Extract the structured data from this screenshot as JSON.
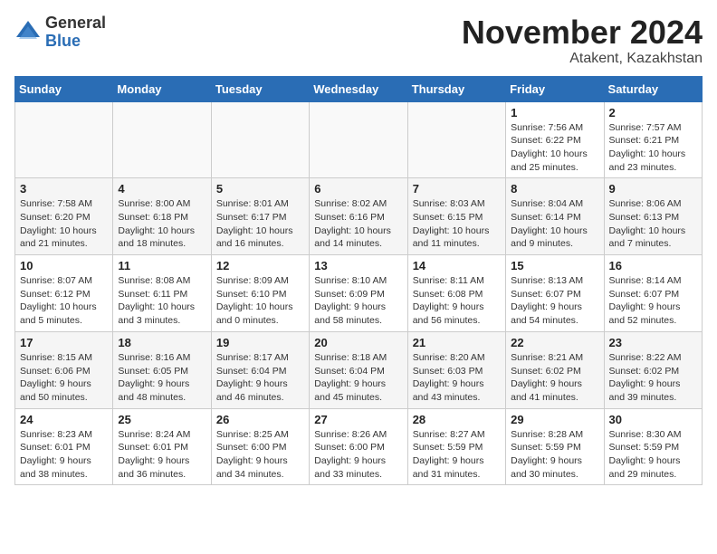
{
  "header": {
    "logo_general": "General",
    "logo_blue": "Blue",
    "month_title": "November 2024",
    "location": "Atakent, Kazakhstan"
  },
  "weekdays": [
    "Sunday",
    "Monday",
    "Tuesday",
    "Wednesday",
    "Thursday",
    "Friday",
    "Saturday"
  ],
  "weeks": [
    [
      {
        "day": "",
        "info": ""
      },
      {
        "day": "",
        "info": ""
      },
      {
        "day": "",
        "info": ""
      },
      {
        "day": "",
        "info": ""
      },
      {
        "day": "",
        "info": ""
      },
      {
        "day": "1",
        "info": "Sunrise: 7:56 AM\nSunset: 6:22 PM\nDaylight: 10 hours and 25 minutes."
      },
      {
        "day": "2",
        "info": "Sunrise: 7:57 AM\nSunset: 6:21 PM\nDaylight: 10 hours and 23 minutes."
      }
    ],
    [
      {
        "day": "3",
        "info": "Sunrise: 7:58 AM\nSunset: 6:20 PM\nDaylight: 10 hours and 21 minutes."
      },
      {
        "day": "4",
        "info": "Sunrise: 8:00 AM\nSunset: 6:18 PM\nDaylight: 10 hours and 18 minutes."
      },
      {
        "day": "5",
        "info": "Sunrise: 8:01 AM\nSunset: 6:17 PM\nDaylight: 10 hours and 16 minutes."
      },
      {
        "day": "6",
        "info": "Sunrise: 8:02 AM\nSunset: 6:16 PM\nDaylight: 10 hours and 14 minutes."
      },
      {
        "day": "7",
        "info": "Sunrise: 8:03 AM\nSunset: 6:15 PM\nDaylight: 10 hours and 11 minutes."
      },
      {
        "day": "8",
        "info": "Sunrise: 8:04 AM\nSunset: 6:14 PM\nDaylight: 10 hours and 9 minutes."
      },
      {
        "day": "9",
        "info": "Sunrise: 8:06 AM\nSunset: 6:13 PM\nDaylight: 10 hours and 7 minutes."
      }
    ],
    [
      {
        "day": "10",
        "info": "Sunrise: 8:07 AM\nSunset: 6:12 PM\nDaylight: 10 hours and 5 minutes."
      },
      {
        "day": "11",
        "info": "Sunrise: 8:08 AM\nSunset: 6:11 PM\nDaylight: 10 hours and 3 minutes."
      },
      {
        "day": "12",
        "info": "Sunrise: 8:09 AM\nSunset: 6:10 PM\nDaylight: 10 hours and 0 minutes."
      },
      {
        "day": "13",
        "info": "Sunrise: 8:10 AM\nSunset: 6:09 PM\nDaylight: 9 hours and 58 minutes."
      },
      {
        "day": "14",
        "info": "Sunrise: 8:11 AM\nSunset: 6:08 PM\nDaylight: 9 hours and 56 minutes."
      },
      {
        "day": "15",
        "info": "Sunrise: 8:13 AM\nSunset: 6:07 PM\nDaylight: 9 hours and 54 minutes."
      },
      {
        "day": "16",
        "info": "Sunrise: 8:14 AM\nSunset: 6:07 PM\nDaylight: 9 hours and 52 minutes."
      }
    ],
    [
      {
        "day": "17",
        "info": "Sunrise: 8:15 AM\nSunset: 6:06 PM\nDaylight: 9 hours and 50 minutes."
      },
      {
        "day": "18",
        "info": "Sunrise: 8:16 AM\nSunset: 6:05 PM\nDaylight: 9 hours and 48 minutes."
      },
      {
        "day": "19",
        "info": "Sunrise: 8:17 AM\nSunset: 6:04 PM\nDaylight: 9 hours and 46 minutes."
      },
      {
        "day": "20",
        "info": "Sunrise: 8:18 AM\nSunset: 6:04 PM\nDaylight: 9 hours and 45 minutes."
      },
      {
        "day": "21",
        "info": "Sunrise: 8:20 AM\nSunset: 6:03 PM\nDaylight: 9 hours and 43 minutes."
      },
      {
        "day": "22",
        "info": "Sunrise: 8:21 AM\nSunset: 6:02 PM\nDaylight: 9 hours and 41 minutes."
      },
      {
        "day": "23",
        "info": "Sunrise: 8:22 AM\nSunset: 6:02 PM\nDaylight: 9 hours and 39 minutes."
      }
    ],
    [
      {
        "day": "24",
        "info": "Sunrise: 8:23 AM\nSunset: 6:01 PM\nDaylight: 9 hours and 38 minutes."
      },
      {
        "day": "25",
        "info": "Sunrise: 8:24 AM\nSunset: 6:01 PM\nDaylight: 9 hours and 36 minutes."
      },
      {
        "day": "26",
        "info": "Sunrise: 8:25 AM\nSunset: 6:00 PM\nDaylight: 9 hours and 34 minutes."
      },
      {
        "day": "27",
        "info": "Sunrise: 8:26 AM\nSunset: 6:00 PM\nDaylight: 9 hours and 33 minutes."
      },
      {
        "day": "28",
        "info": "Sunrise: 8:27 AM\nSunset: 5:59 PM\nDaylight: 9 hours and 31 minutes."
      },
      {
        "day": "29",
        "info": "Sunrise: 8:28 AM\nSunset: 5:59 PM\nDaylight: 9 hours and 30 minutes."
      },
      {
        "day": "30",
        "info": "Sunrise: 8:30 AM\nSunset: 5:59 PM\nDaylight: 9 hours and 29 minutes."
      }
    ]
  ]
}
